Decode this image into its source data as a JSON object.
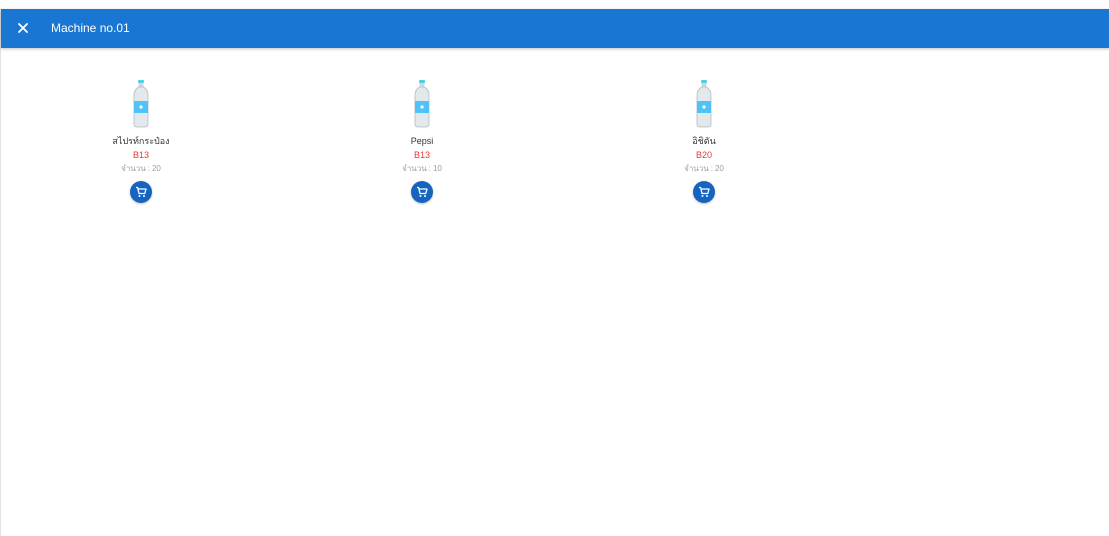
{
  "header": {
    "title": "Machine no.01",
    "close_icon": "close-icon",
    "background_color": "#1976d2"
  },
  "products": [
    {
      "name": "สไปรท์กระป๋อง",
      "code": "B13",
      "quantity_label": "จำนวน",
      "quantity_separator": ":",
      "quantity": "20",
      "icon": "water-bottle-icon",
      "action_icon": "cart-icon"
    },
    {
      "name": "Pepsi",
      "code": "B13",
      "quantity_label": "จำนวน",
      "quantity_separator": ":",
      "quantity": "10",
      "icon": "water-bottle-icon",
      "action_icon": "cart-icon"
    },
    {
      "name": "อิชิตัน",
      "code": "B20",
      "quantity_label": "จำนวน",
      "quantity_separator": ":",
      "quantity": "20",
      "icon": "water-bottle-icon",
      "action_icon": "cart-icon"
    }
  ],
  "colors": {
    "code_text": "#e53935",
    "cart_button": "#1565c0",
    "quantity_text": "#9e9e9e"
  }
}
